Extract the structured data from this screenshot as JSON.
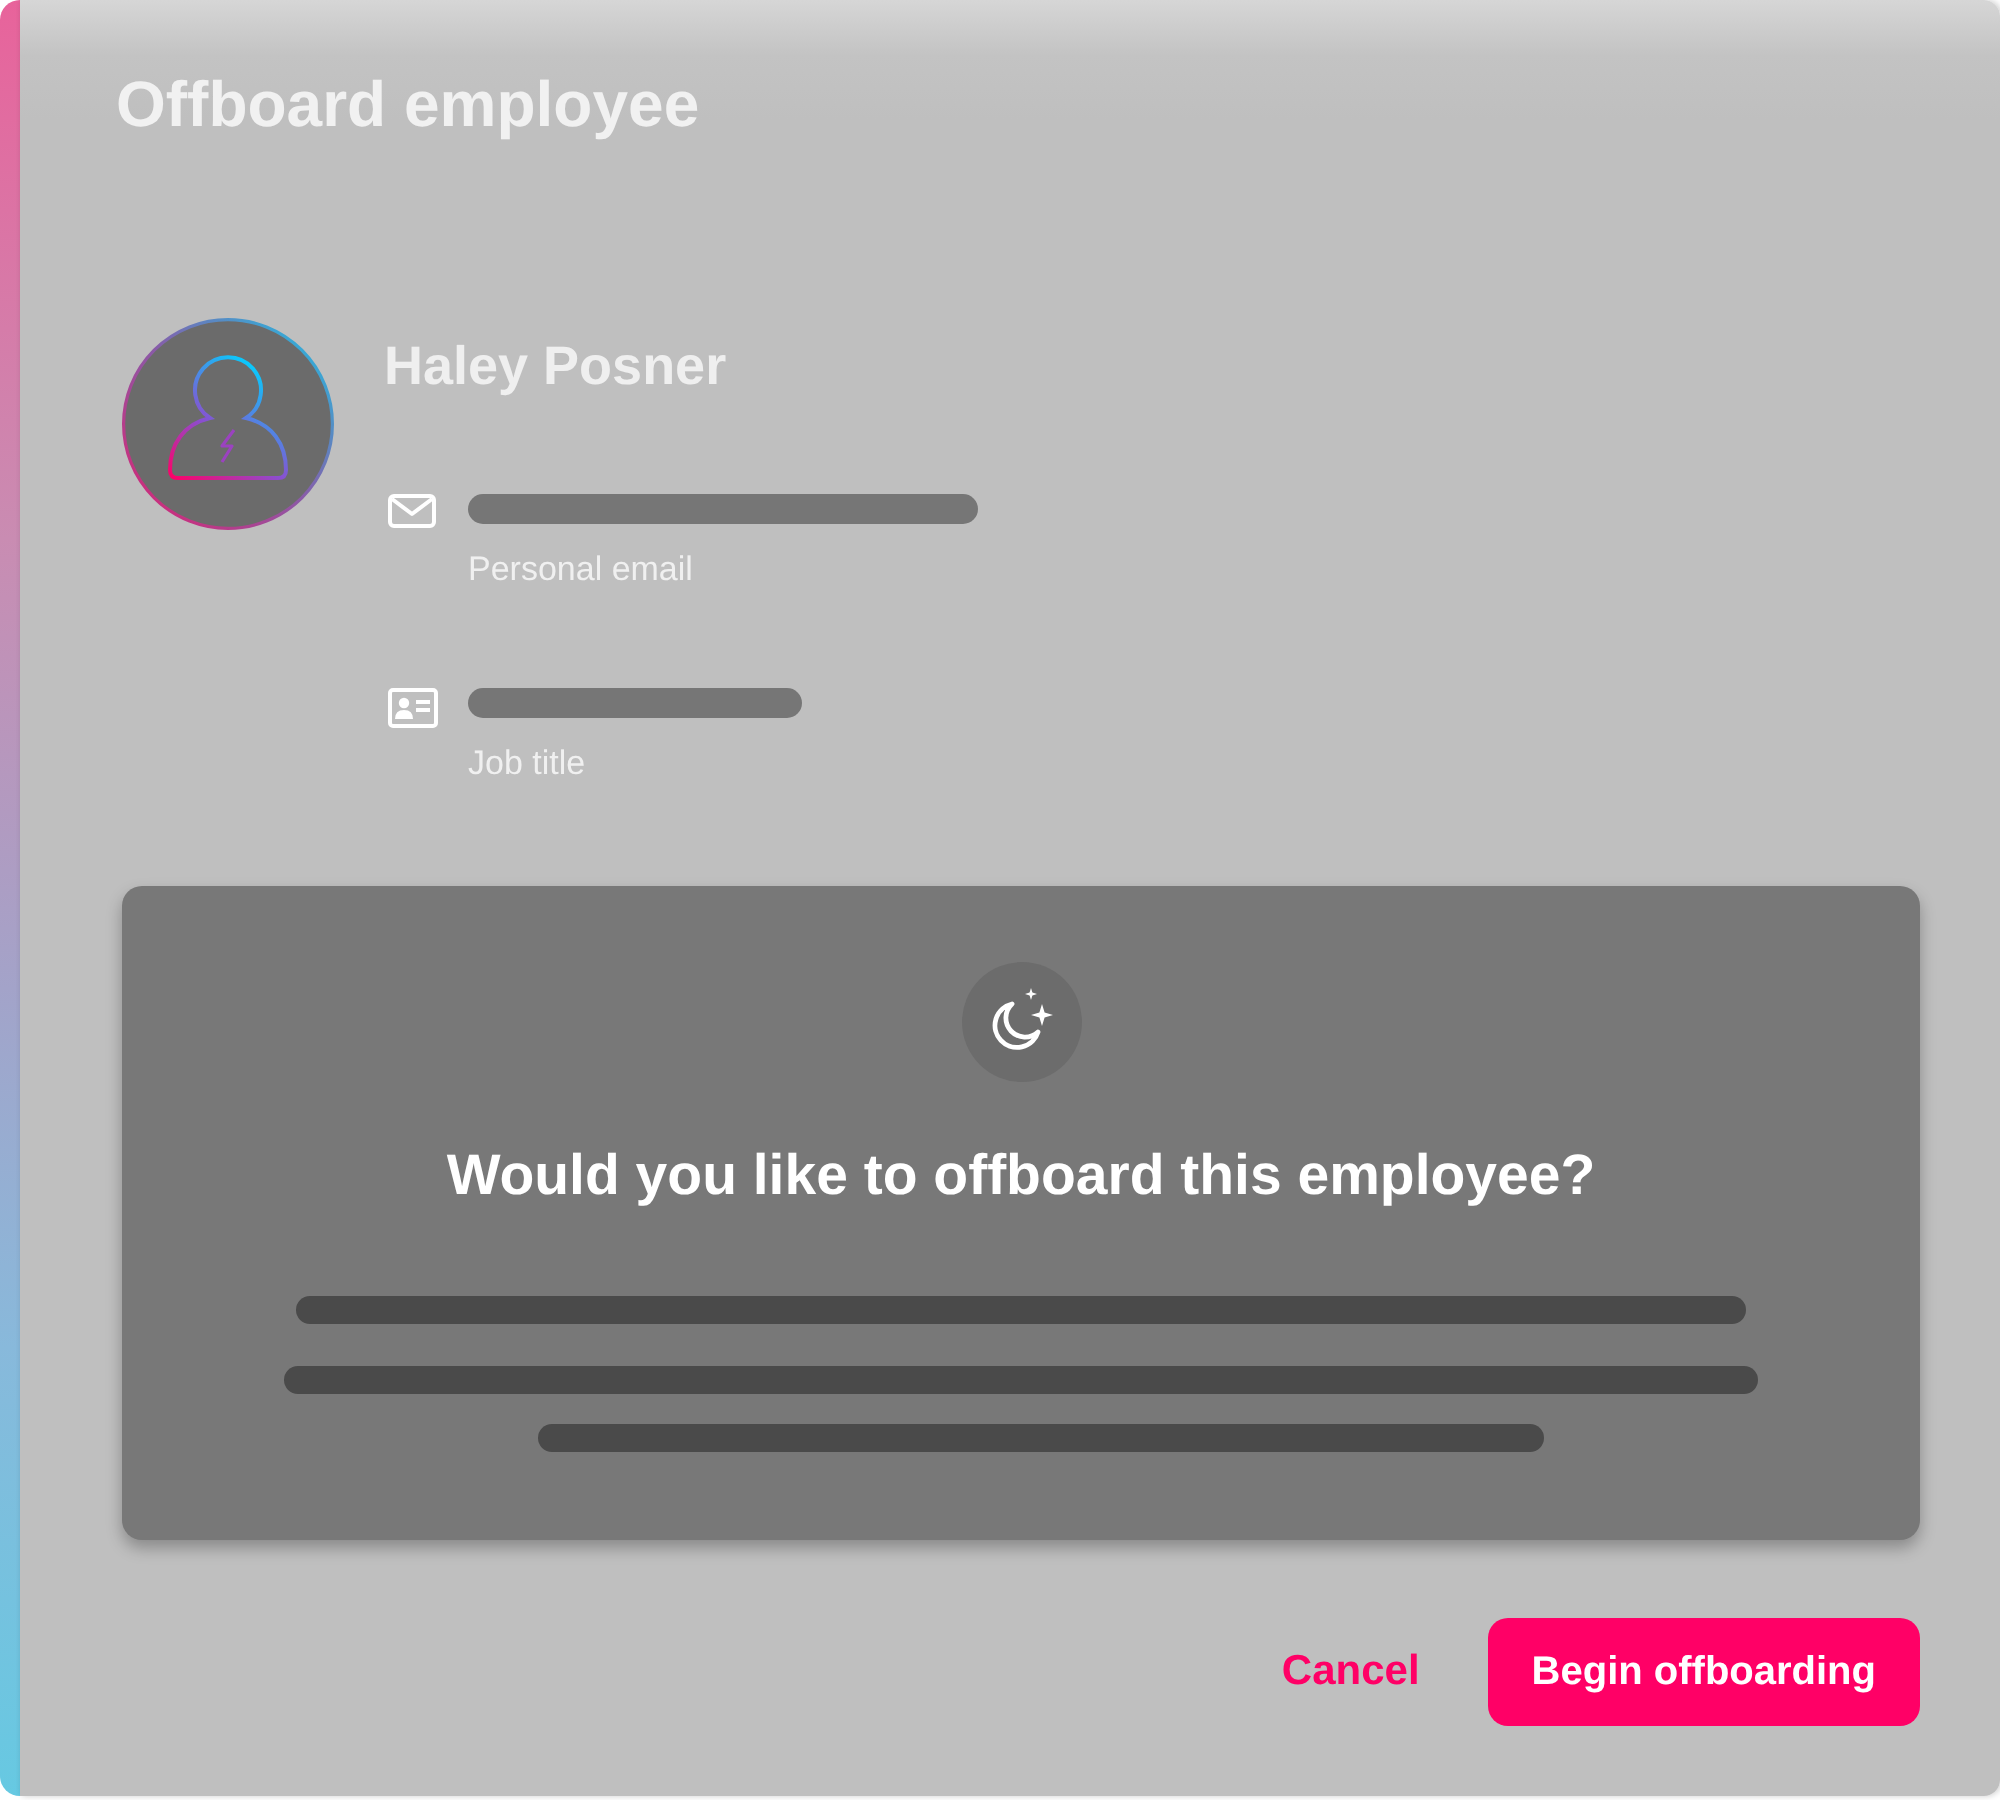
{
  "dialog": {
    "title": "Offboard employee"
  },
  "employee": {
    "name": "Haley Posner",
    "fields": [
      {
        "kind": "email",
        "label": "Personal email",
        "redacted": true
      },
      {
        "kind": "job",
        "label": "Job title",
        "redacted": true
      }
    ]
  },
  "prompt": {
    "heading": "Would you like to offboard this employee?",
    "description_redacted": true
  },
  "buttons": [
    {
      "kind": "text",
      "label": "Cancel"
    },
    {
      "kind": "primary",
      "label": "Begin offboarding"
    }
  ]
}
